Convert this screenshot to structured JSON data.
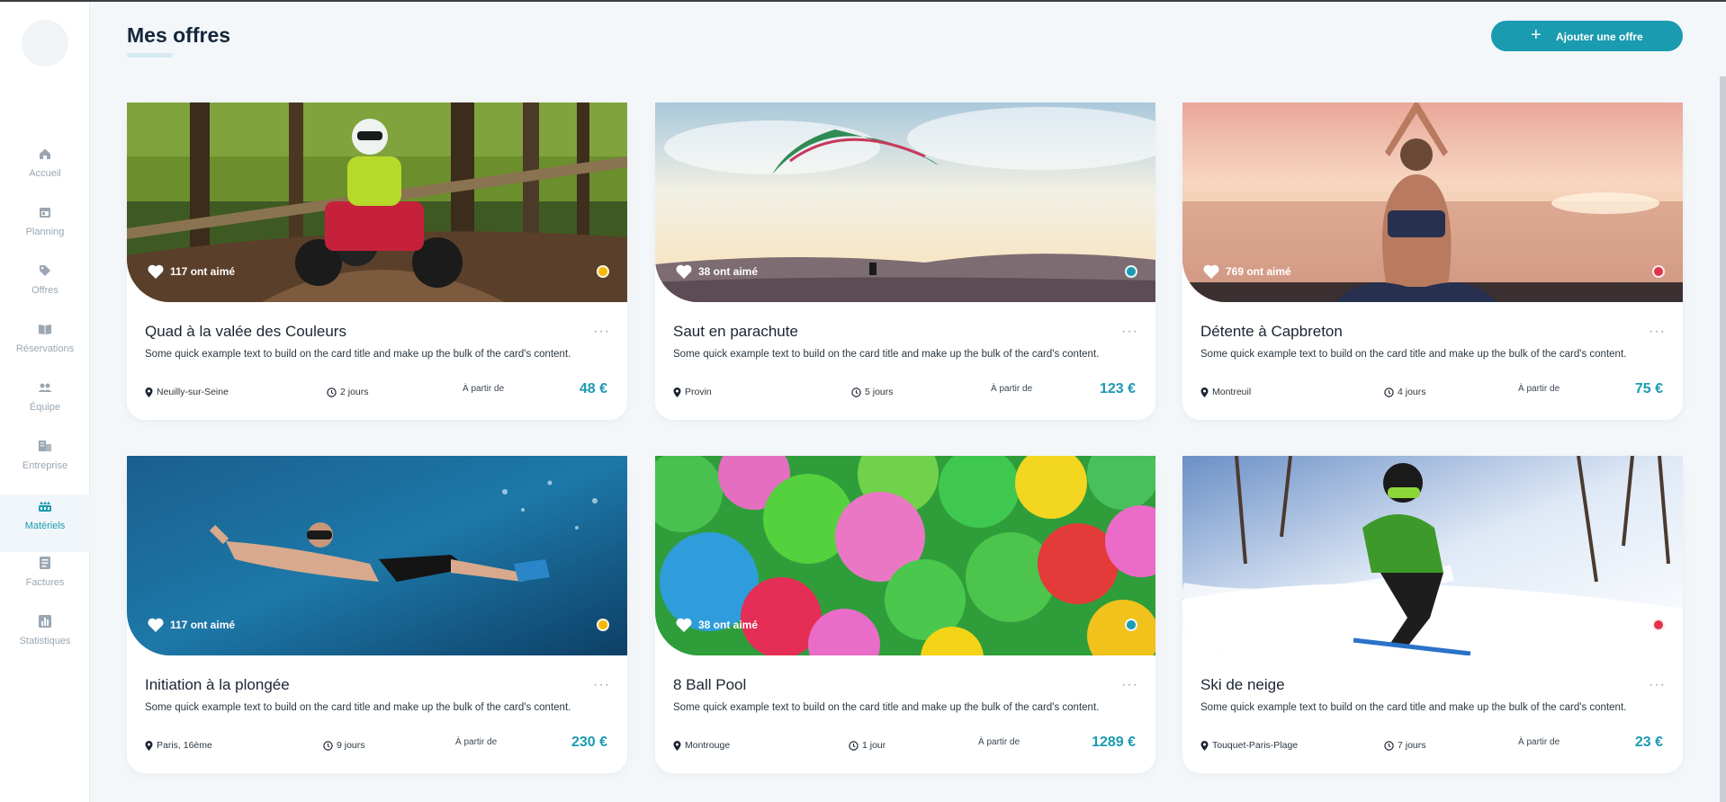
{
  "nav": {
    "items": [
      {
        "label": "Accueil",
        "icon": "home-icon"
      },
      {
        "label": "Planning",
        "icon": "calendar-icon"
      },
      {
        "label": "Offres",
        "icon": "tag-icon"
      },
      {
        "label": "Réservations",
        "icon": "book-icon"
      },
      {
        "label": "Équipe",
        "icon": "team-icon"
      },
      {
        "label": "Entreprise",
        "icon": "building-icon"
      },
      {
        "label": "Matériels",
        "icon": "equipment-icon",
        "active": true
      },
      {
        "label": "Factures",
        "icon": "invoice-icon"
      },
      {
        "label": "Statistiques",
        "icon": "stats-icon"
      }
    ]
  },
  "header": {
    "title": "Mes offres",
    "add_button": "Ajouter une offre"
  },
  "common": {
    "description": "Some quick example text to build on the card title and make up the bulk of the card's content.",
    "price_prefix": "À partir de",
    "more": "···"
  },
  "offers": [
    {
      "title": "Quad à la valée des Couleurs",
      "likes": "117 ont aimé",
      "location": "Neuilly-sur-Seine",
      "duration": "2 jours",
      "price": "48 €",
      "status_color": "#f5b800",
      "image": "quad-photo"
    },
    {
      "title": "Saut en parachute",
      "likes": "38 ont aimé",
      "location": "Provin",
      "duration": "5 jours",
      "price": "123 €",
      "status_color": "#1a9bb0",
      "image": "paraglider-photo"
    },
    {
      "title": "Détente à Capbreton",
      "likes": "769 ont aimé",
      "location": "Montreuil",
      "duration": "4 jours",
      "price": "75 €",
      "status_color": "#e0344a",
      "image": "yoga-photo"
    },
    {
      "title": "Initiation à la plongée",
      "likes": "117 ont aimé",
      "location": "Paris, 16ème",
      "duration": "9 jours",
      "price": "230 €",
      "status_color": "#f5b800",
      "image": "diving-photo"
    },
    {
      "title": "8 Ball Pool",
      "likes": "38 ont aimé",
      "location": "Montrouge",
      "duration": "1 jour",
      "price": "1289 €",
      "status_color": "#1a9bb0",
      "image": "ball-pool-photo"
    },
    {
      "title": "Ski de neige",
      "likes": "",
      "location": "Touquet-Paris-Plage",
      "duration": "7 jours",
      "price": "23 €",
      "status_color": "#e0344a",
      "image": "ski-photo"
    }
  ],
  "colors": {
    "accent": "#1a9bb0",
    "sidebar_bg": "#ffffff",
    "page_bg": "#f4f7f9"
  }
}
